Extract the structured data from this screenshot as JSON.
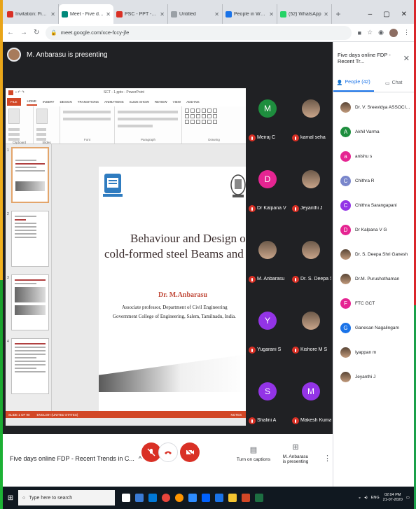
{
  "browser": {
    "tabs": [
      {
        "label": "Invitation: Five days online F",
        "color": "#d93025",
        "active": false
      },
      {
        "label": "Meet - Five days online F",
        "color": "#00897b",
        "active": true
      },
      {
        "label": "PSC - PPT - sreevidyaasokri",
        "color": "#d93025",
        "active": false
      },
      {
        "label": "Untitled",
        "color": "#9aa0a6",
        "active": false
      },
      {
        "label": "People in WCW-IITCEMM-C",
        "color": "#1a73e8",
        "active": false
      },
      {
        "label": "(52) WhatsApp",
        "color": "#25d366",
        "active": false
      }
    ],
    "url": "meet.google.com/xce-fccy-jfe"
  },
  "meet": {
    "presenter_label": "M. Anbarasu is presenting",
    "meeting_title": "Five days online FDP - Recent Trends in C...",
    "captions_label": "Turn on captions",
    "presenting_label": "M. Anbarasu\nis presenting"
  },
  "ppt": {
    "window_title": "SCT - 1.pptx - PowerPoint",
    "tabs": [
      "FILE",
      "HOME",
      "INSERT",
      "DESIGN",
      "TRANSITIONS",
      "ANIMATIONS",
      "SLIDE SHOW",
      "REVIEW",
      "VIEW",
      "ADD-INS"
    ],
    "groups": [
      "Clipboard",
      "Slides",
      "Font",
      "Paragraph",
      "Drawing"
    ],
    "thumb_numbers": [
      "1",
      "2",
      "3",
      "4"
    ],
    "status_left": "SLIDE 1 OF 90",
    "status_lang": "ENGLISH (UNITED STATES)",
    "status_right": "NOTES",
    "slide": {
      "title_line1": "Behaviour and Design of",
      "title_line2": "cold-formed steel Beams and columns",
      "author": "Dr. M.Anbarasu",
      "line1": "Associate professor, Department of Civil Engineering",
      "line2": "Government College of Engineering, Salem, Tamilnadu, India."
    }
  },
  "tiles": [
    {
      "name": "Meiraj C",
      "initial": "M",
      "color": "#1e8e3e",
      "photo": false
    },
    {
      "name": "kamal seha",
      "initial": "",
      "color": "#5f6368",
      "photo": true
    },
    {
      "name": "Dr Kalpana V G",
      "initial": "D",
      "color": "#e52592",
      "photo": false
    },
    {
      "name": "Jeyanthi J",
      "initial": "",
      "color": "#5f6368",
      "photo": true
    },
    {
      "name": "M. Anbarasu",
      "initial": "",
      "color": "#5f6368",
      "photo": true
    },
    {
      "name": "Dr. S. Deepa Shri...",
      "initial": "",
      "color": "#5f6368",
      "photo": true
    },
    {
      "name": "Yugarani S",
      "initial": "Y",
      "color": "#9334e6",
      "photo": false
    },
    {
      "name": "Kishore M S",
      "initial": "",
      "color": "#5f6368",
      "photo": true
    },
    {
      "name": "Shalini A",
      "initial": "S",
      "color": "#9334e6",
      "photo": false
    },
    {
      "name": "Makesh Kumar",
      "initial": "M",
      "color": "#9334e6",
      "photo": false
    }
  ],
  "panel": {
    "title": "Five days online FDP - Recent Tr...",
    "people_tab": "People (42)",
    "chat_tab": "Chat",
    "people": [
      {
        "name": "Dr. V. Sreevidya ASSOCIATE PR...",
        "initial": "",
        "color": "#8d6e63",
        "photo": true
      },
      {
        "name": "Akhil Varma",
        "initial": "A",
        "color": "#1e8e3e",
        "photo": false
      },
      {
        "name": "anishu s",
        "initial": "a",
        "color": "#e52592",
        "photo": false
      },
      {
        "name": "Chithra R",
        "initial": "C",
        "color": "#7986cb",
        "photo": false
      },
      {
        "name": "Chithra Sarangapani",
        "initial": "C",
        "color": "#9334e6",
        "photo": false
      },
      {
        "name": "Dr Kalpana V G",
        "initial": "D",
        "color": "#e52592",
        "photo": false
      },
      {
        "name": "Dr. S. Deepa Shri Ganesh",
        "initial": "",
        "color": "#8d6e63",
        "photo": true
      },
      {
        "name": "Dr.M. Purushothaman",
        "initial": "",
        "color": "#8d6e63",
        "photo": true
      },
      {
        "name": "FTC GCT",
        "initial": "F",
        "color": "#e52592",
        "photo": false
      },
      {
        "name": "Ganesan Nagalingam",
        "initial": "G",
        "color": "#1a73e8",
        "photo": false
      },
      {
        "name": "Iyappan m",
        "initial": "",
        "color": "#8d6e63",
        "photo": true
      },
      {
        "name": "Jeyanthi J",
        "initial": "",
        "color": "#8d6e63",
        "photo": true
      }
    ]
  },
  "taskbar": {
    "search_placeholder": "Type here to search",
    "time": "02:04 PM",
    "date": "21-07-2020",
    "lang": "ENG"
  }
}
